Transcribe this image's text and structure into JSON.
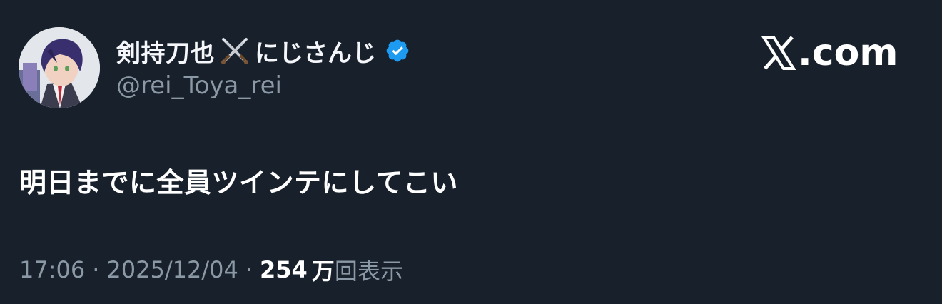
{
  "author": {
    "display_name": "剣持刀也",
    "display_name_suffix": "にじさんじ",
    "handle": "@rei_Toya_rei",
    "name_emoji": "crossed-swords-icon",
    "verified": true,
    "verified_color": "#1d9bf0"
  },
  "brand": {
    "logo_text": ".com",
    "logo_icon": "x-logo-icon"
  },
  "tweet": {
    "text": "明日までに全員ツインテにしてこい"
  },
  "meta": {
    "time": "17:06",
    "separator": "·",
    "date": "2025/12/04",
    "views_count": "254",
    "views_unit": "万",
    "views_label": "回表示"
  },
  "colors": {
    "background": "#17202b",
    "secondary_text": "#8b98a5",
    "primary_text": "#ffffff"
  }
}
